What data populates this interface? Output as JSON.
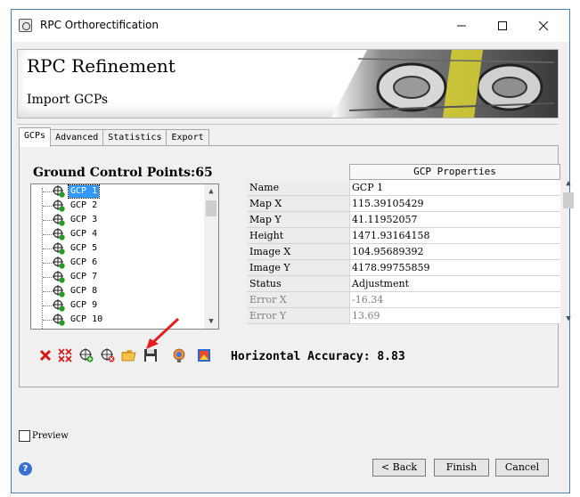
{
  "window": {
    "title": "RPC Orthorectification",
    "minimize": "—",
    "maximize": "☐",
    "close": "✕"
  },
  "header": {
    "title": "RPC Refinement",
    "subtitle": "Import GCPs"
  },
  "tabs": [
    "GCPs",
    "Advanced",
    "Statistics",
    "Export"
  ],
  "active_tab": "GCPs",
  "gcp_list": {
    "heading": "Ground Control Points:65",
    "items": [
      "GCP 1",
      "GCP 2",
      "GCP 3",
      "GCP 4",
      "GCP 5",
      "GCP 6",
      "GCP 7",
      "GCP 8",
      "GCP 9",
      "GCP 10"
    ],
    "selected": "GCP 1"
  },
  "properties": {
    "header": "GCP Properties",
    "rows": [
      {
        "name": "Name",
        "value": "GCP 1"
      },
      {
        "name": "Map X",
        "value": "115.39105429"
      },
      {
        "name": "Map Y",
        "value": "41.11952057"
      },
      {
        "name": "Height",
        "value": "1471.93164158"
      },
      {
        "name": "Image X",
        "value": "104.95689392"
      },
      {
        "name": "Image Y",
        "value": "4178.99755859"
      },
      {
        "name": "Status",
        "value": "Adjustment"
      },
      {
        "name": "Error X",
        "value": "-16.34"
      },
      {
        "name": "Error Y",
        "value": "13.69"
      }
    ]
  },
  "toolbar": {
    "icons": [
      "delete-icon",
      "delete-all-icon",
      "add-gcp-icon",
      "remove-gcp-icon",
      "open-folder-icon",
      "save-icon",
      "info-icon",
      "image-icon"
    ],
    "accuracy_label": "Horizontal Accuracy: 8.83"
  },
  "preview": {
    "label": "Preview"
  },
  "buttons": {
    "back": "< Back",
    "finish": "Finish",
    "cancel": "Cancel"
  },
  "colors": {
    "selection": "#3399ff",
    "window_border": "#4a7fb5",
    "arrow": "#e02020"
  }
}
